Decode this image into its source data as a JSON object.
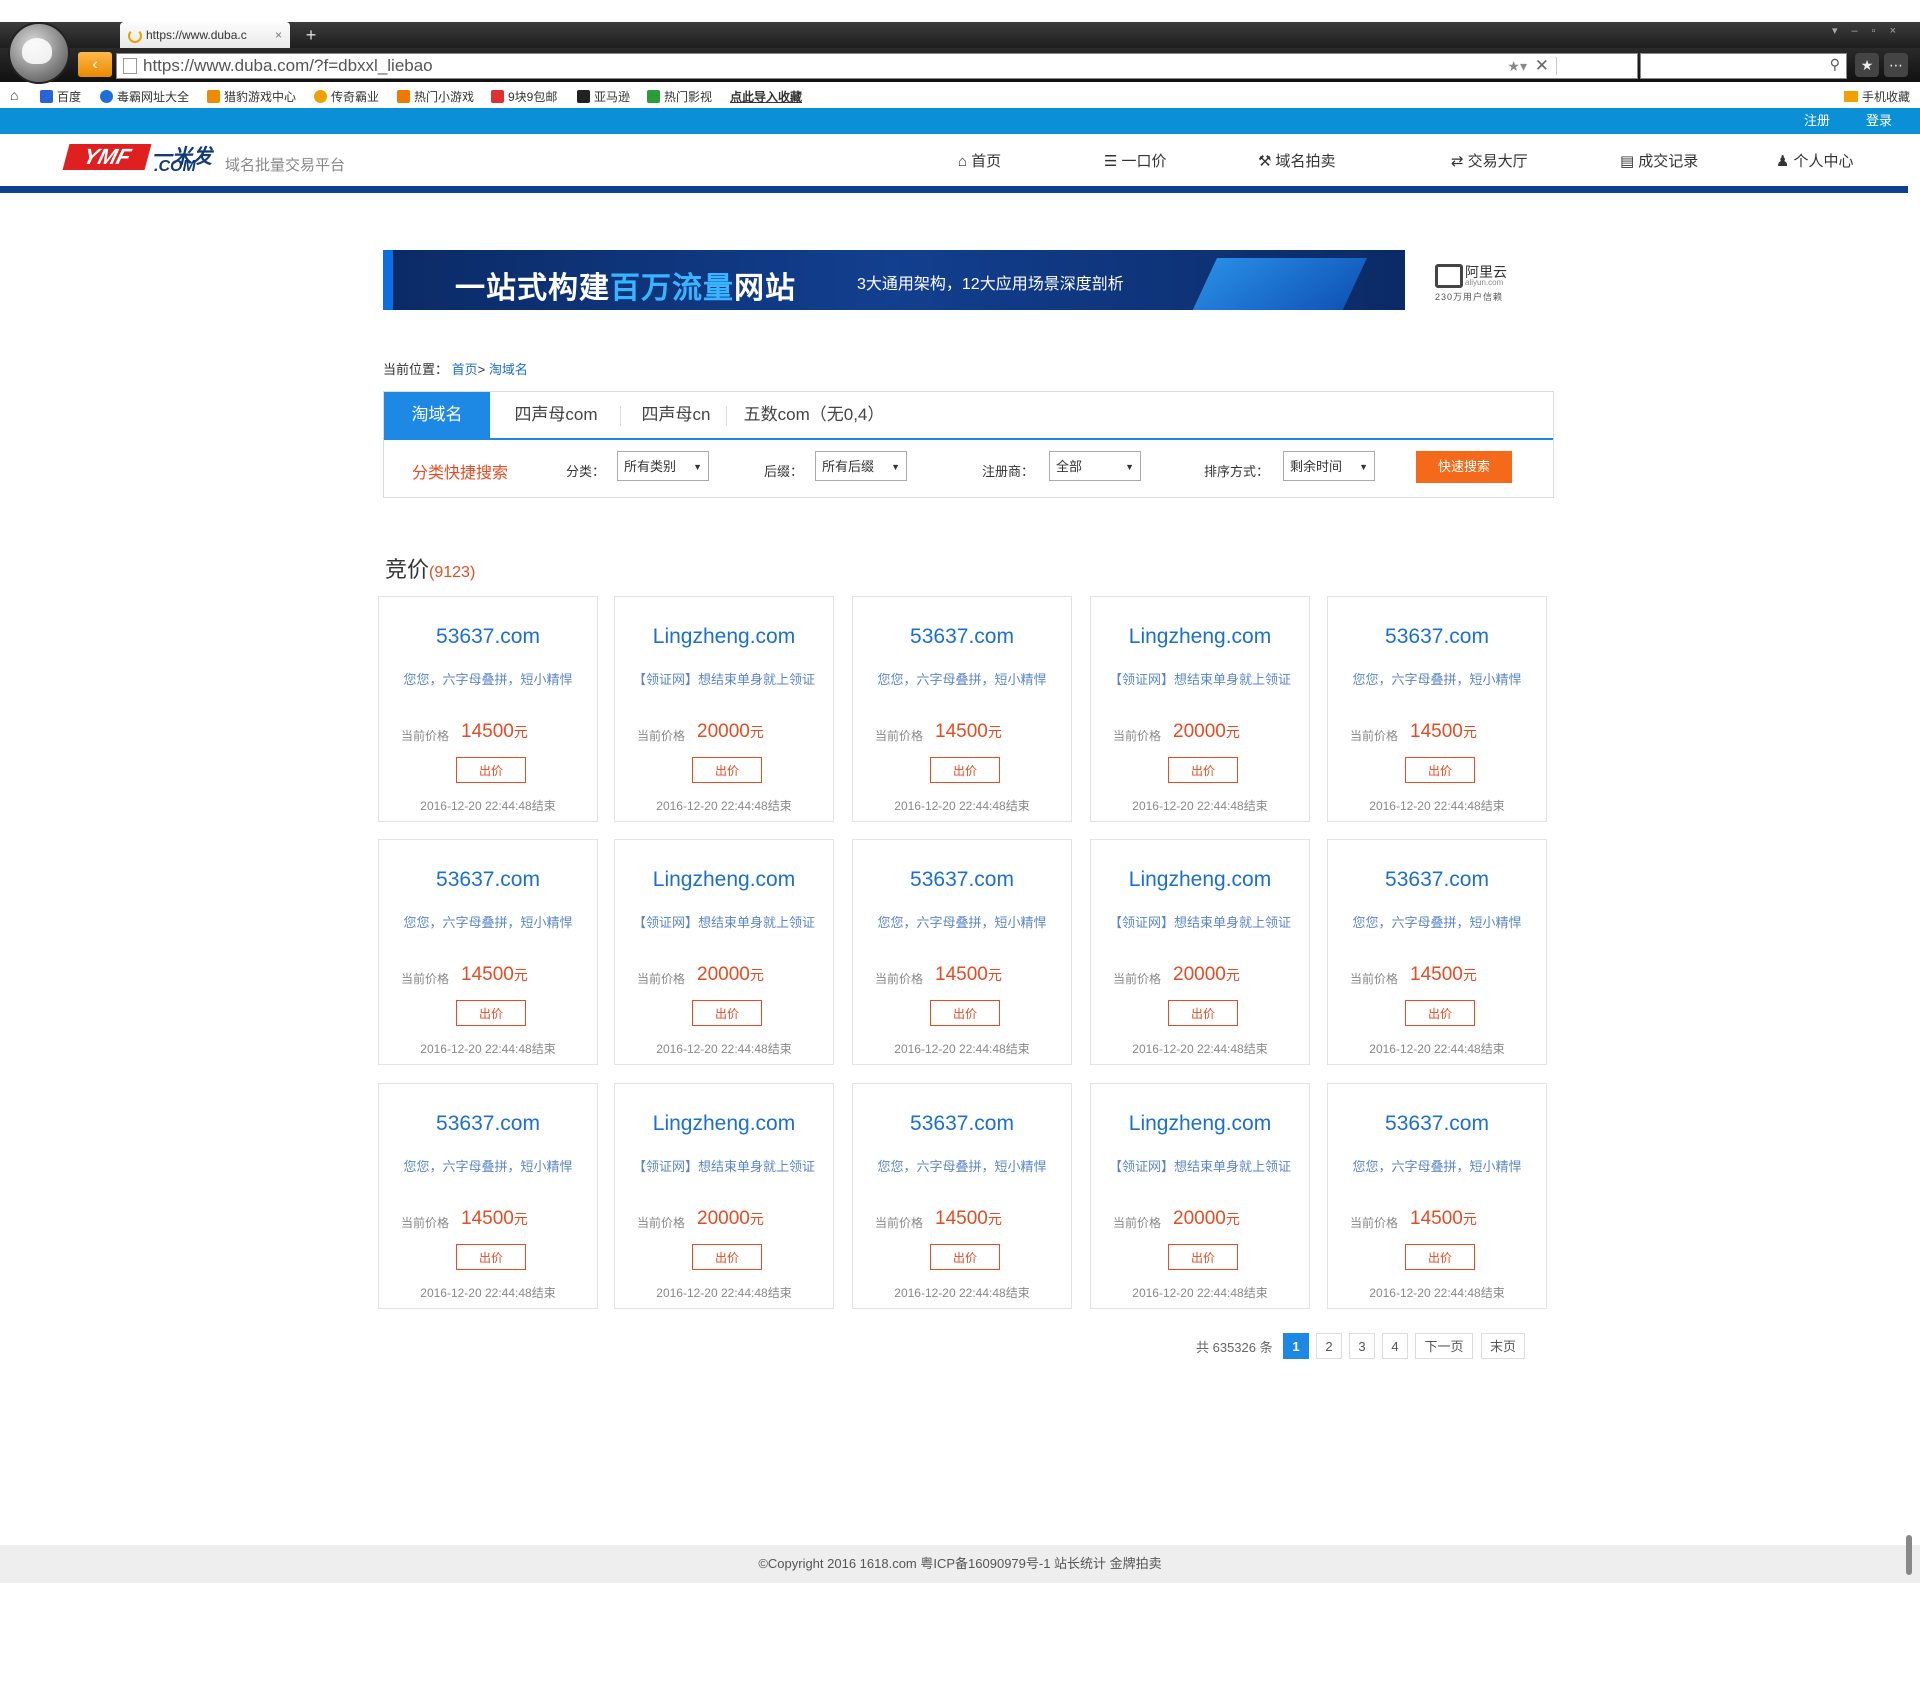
{
  "browser": {
    "tab_title": "https://www.duba.c",
    "tab_close": "×",
    "new_tab": "+",
    "url": "https://www.duba.com/?f=dbxxl_liebao",
    "window_controls": "▾–▫×"
  },
  "bookmarks": {
    "items": [
      "百度",
      "毒霸网址大全",
      "猎豹游戏中心",
      "传奇霸业",
      "热门小游戏",
      "9块9包邮",
      "亚马逊",
      "热门影视",
      "点此导入收藏"
    ],
    "right": "手机收藏"
  },
  "site": {
    "register": "注册",
    "login": "登录",
    "logo_text": "YMF",
    "logo_cn": "一米发",
    "logo_com": ".COM",
    "subtitle": "域名批量交易平台",
    "nav": [
      {
        "icon": "home-icon",
        "glyph": "⌂",
        "label": "首页"
      },
      {
        "icon": "list-icon",
        "glyph": "☰",
        "label": "一口价"
      },
      {
        "icon": "gavel-icon",
        "glyph": "⚒",
        "label": "域名拍卖"
      },
      {
        "icon": "exchange-icon",
        "glyph": "⇄",
        "label": "交易大厅"
      },
      {
        "icon": "records-icon",
        "glyph": "▤",
        "label": "成交记录"
      },
      {
        "icon": "user-icon",
        "glyph": "♟",
        "label": "个人中心"
      }
    ]
  },
  "banner": {
    "headline_a": "一站式构建",
    "headline_b": "百万流量",
    "headline_c": "网站",
    "sub": "3大通用架构，12大应用场景深度剖析",
    "brand": "阿里云",
    "brand_domain": "aliyun.com",
    "brand_users": "230万用户信赖"
  },
  "breadcrumb": {
    "prefix": "当前位置：",
    "home": "首页",
    "sep": ">",
    "current": "淘域名"
  },
  "tabs": [
    "淘域名",
    "四声母com",
    "四声母cn",
    "五数com（无0,4）"
  ],
  "filter": {
    "title": "分类快捷搜索",
    "category_label": "分类：",
    "category_value": "所有类别",
    "suffix_label": "后缀：",
    "suffix_value": "所有后缀",
    "registrar_label": "注册商：",
    "registrar_value": "全部",
    "sort_label": "排序方式：",
    "sort_value": "剩余时间",
    "search_button": "快速搜索"
  },
  "auction": {
    "title": "竞价",
    "count": "(9123)",
    "price_label": "当前价格",
    "currency": "元",
    "bid_label": "出价",
    "end_suffix": "结束",
    "cards": [
      {
        "domain": "53637.com",
        "desc": "您您，六字母叠拼，短小精悍",
        "price": "14500",
        "end": "2016-12-20 22:44:48"
      },
      {
        "domain": "Lingzheng.com",
        "desc": "【领证网】想结束单身就上领证",
        "price": "20000",
        "end": "2016-12-20 22:44:48"
      },
      {
        "domain": "53637.com",
        "desc": "您您，六字母叠拼，短小精悍",
        "price": "14500",
        "end": "2016-12-20 22:44:48"
      },
      {
        "domain": "Lingzheng.com",
        "desc": "【领证网】想结束单身就上领证",
        "price": "20000",
        "end": "2016-12-20 22:44:48"
      },
      {
        "domain": "53637.com",
        "desc": "您您，六字母叠拼，短小精悍",
        "price": "14500",
        "end": "2016-12-20 22:44:48"
      },
      {
        "domain": "53637.com",
        "desc": "您您，六字母叠拼，短小精悍",
        "price": "14500",
        "end": "2016-12-20 22:44:48"
      },
      {
        "domain": "Lingzheng.com",
        "desc": "【领证网】想结束单身就上领证",
        "price": "20000",
        "end": "2016-12-20 22:44:48"
      },
      {
        "domain": "53637.com",
        "desc": "您您，六字母叠拼，短小精悍",
        "price": "14500",
        "end": "2016-12-20 22:44:48"
      },
      {
        "domain": "Lingzheng.com",
        "desc": "【领证网】想结束单身就上领证",
        "price": "20000",
        "end": "2016-12-20 22:44:48"
      },
      {
        "domain": "53637.com",
        "desc": "您您，六字母叠拼，短小精悍",
        "price": "14500",
        "end": "2016-12-20 22:44:48"
      },
      {
        "domain": "53637.com",
        "desc": "您您，六字母叠拼，短小精悍",
        "price": "14500",
        "end": "2016-12-20 22:44:48"
      },
      {
        "domain": "Lingzheng.com",
        "desc": "【领证网】想结束单身就上领证",
        "price": "20000",
        "end": "2016-12-20 22:44:48"
      },
      {
        "domain": "53637.com",
        "desc": "您您，六字母叠拼，短小精悍",
        "price": "14500",
        "end": "2016-12-20 22:44:48"
      },
      {
        "domain": "Lingzheng.com",
        "desc": "【领证网】想结束单身就上领证",
        "price": "20000",
        "end": "2016-12-20 22:44:48"
      },
      {
        "domain": "53637.com",
        "desc": "您您，六字母叠拼，短小精悍",
        "price": "14500",
        "end": "2016-12-20 22:44:48"
      }
    ]
  },
  "pager": {
    "total": "共 635326 条",
    "pages": [
      "1",
      "2",
      "3",
      "4"
    ],
    "current": "1",
    "next": "下一页",
    "last": "末页"
  },
  "footer": {
    "text": "©Copyright 2016 1618.com 粤ICP备16090979号-1 站长统计 金牌拍卖"
  },
  "colors": {
    "accent_blue": "#1e88e5",
    "top_strip": "#0b8fd6",
    "header_rule": "#0f3f8f",
    "price_red": "#e84b22",
    "search_orange": "#f56a1a"
  }
}
